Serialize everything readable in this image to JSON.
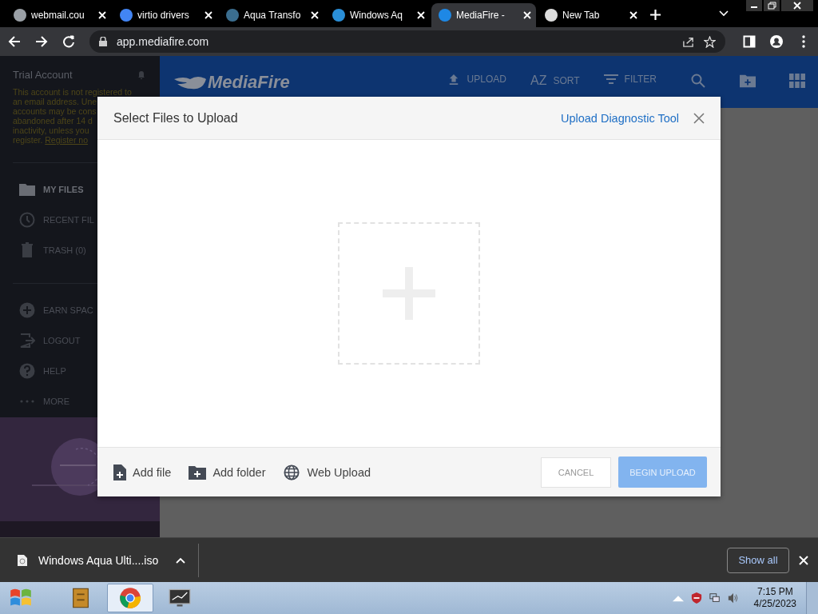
{
  "browser": {
    "tabs": [
      {
        "title": "webmail.cou",
        "selected": false,
        "color": "#9aa0a6"
      },
      {
        "title": "virtio drivers",
        "selected": false,
        "color": "#4285f4"
      },
      {
        "title": "Aqua Transfo",
        "selected": false,
        "color": "#3b6e8f"
      },
      {
        "title": "Windows Aq",
        "selected": false,
        "color": "#2a8fd8"
      },
      {
        "title": "MediaFire -",
        "selected": true,
        "color": "#1e88e5"
      },
      {
        "title": "New Tab",
        "selected": false,
        "color": "#dddddd"
      }
    ],
    "address": "app.mediafire.com"
  },
  "sidebar": {
    "account_title": "Trial Account",
    "notice_lines": [
      "This account is not registered to",
      "an email address. Une",
      "accounts may be cons",
      "abandoned after 14 d",
      "inactivity, unless you",
      "register. "
    ],
    "register_link": "Register no",
    "items": [
      {
        "label": "MY FILES",
        "kind": "folder",
        "selected": true
      },
      {
        "label": "RECENT FIL",
        "kind": "clock",
        "selected": false
      },
      {
        "label": "TRASH (0)",
        "kind": "trash",
        "selected": false
      },
      {
        "label": "EARN SPAC",
        "kind": "plus",
        "selected": false
      },
      {
        "label": "LOGOUT",
        "kind": "logout",
        "selected": false
      },
      {
        "label": "HELP",
        "kind": "help",
        "selected": false
      },
      {
        "label": "MORE",
        "kind": "more",
        "selected": false
      }
    ]
  },
  "header": {
    "logo": "MediaFire",
    "actions": [
      {
        "label": "UPLOAD",
        "kind": "upload"
      },
      {
        "label": "SORT",
        "kind": "sort"
      },
      {
        "label": "FILTER",
        "kind": "filter"
      }
    ],
    "sort_glyph": "AZ"
  },
  "dialog": {
    "title": "Select Files to Upload",
    "diagnostic_link": "Upload Diagnostic Tool",
    "sources": [
      {
        "label": "Add file",
        "kind": "file"
      },
      {
        "label": "Add folder",
        "kind": "folder"
      },
      {
        "label": "Web Upload",
        "kind": "globe"
      }
    ],
    "cancel": "CANCEL",
    "begin": {
      "label": "BEGIN UPLOAD",
      "disabled": true
    }
  },
  "download_bar": {
    "file": "Windows Aqua Ulti....iso",
    "show_all": "Show all"
  },
  "taskbar": {
    "time": "7:15 PM",
    "date": "4/25/2023",
    "apps": [
      {
        "kind": "files",
        "selected": false
      },
      {
        "kind": "chrome",
        "selected": true
      },
      {
        "kind": "monitor",
        "selected": false
      }
    ]
  }
}
